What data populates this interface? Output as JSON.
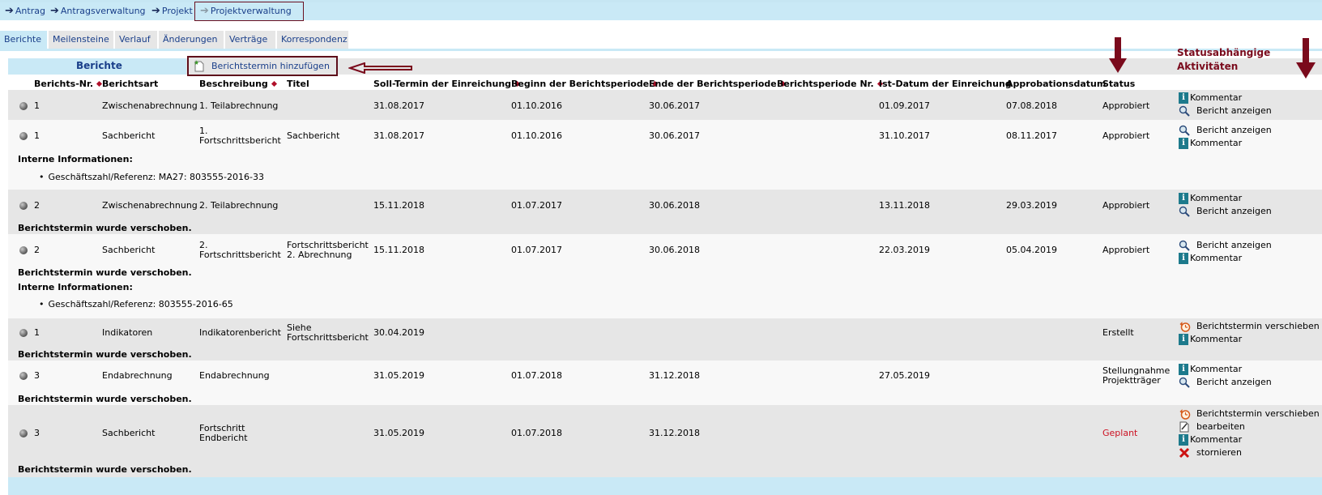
{
  "breadcrumb": [
    {
      "label": "Antrag"
    },
    {
      "label": "Antragsverwaltung"
    },
    {
      "label": "Projekt"
    },
    {
      "label": "Projektverwaltung"
    }
  ],
  "tabs": [
    {
      "label": "Berichte",
      "active": true
    },
    {
      "label": "Meilensteine"
    },
    {
      "label": "Verlauf"
    },
    {
      "label": "Änderungen"
    },
    {
      "label": "Verträge"
    },
    {
      "label": "Korrespondenz"
    }
  ],
  "section": {
    "title": "Berichte",
    "add_button": "Berichtstermin hinzufügen"
  },
  "annotation": {
    "line1": "Statusabhängige",
    "line2": "Aktivitäten"
  },
  "columns": [
    {
      "label": "Berichts-Nr.",
      "sortable": true
    },
    {
      "label": "Berichtsart"
    },
    {
      "label": "Beschreibung",
      "sortable": true
    },
    {
      "label": "Titel"
    },
    {
      "label": "Soll-Termin der Einreichung",
      "sortable": true
    },
    {
      "label": "Beginn der Berichtsperiode",
      "sortable": true
    },
    {
      "label": "Ende der Berichtsperiode",
      "sortable": true
    },
    {
      "label": "Berichtsperiode Nr.",
      "sortable": true
    },
    {
      "label": "Ist-Datum der Einreichung"
    },
    {
      "label": "Approbationsdatum"
    },
    {
      "label": "Status"
    }
  ],
  "rows": [
    {
      "nr": "1",
      "art": "Zwischenabrechnung",
      "beschreibung": "1. Teilabrechnung",
      "titel": "",
      "soll": "31.08.2017",
      "beginn": "01.10.2016",
      "ende": "30.06.2017",
      "periode_nr": "",
      "ist": "01.09.2017",
      "approbation": "07.08.2018",
      "status": "Approbiert",
      "actions": [
        "Kommentar",
        "Bericht anzeigen"
      ]
    },
    {
      "nr": "1",
      "art": "Sachbericht",
      "beschreibung_l1": "1.",
      "beschreibung_l2": "Fortschrittsbericht",
      "titel": "Sachbericht",
      "soll": "31.08.2017",
      "beginn": "01.10.2016",
      "ende": "30.06.2017",
      "periode_nr": "",
      "ist": "31.10.2017",
      "approbation": "08.11.2017",
      "status": "Approbiert",
      "actions": [
        "Bericht anzeigen",
        "Kommentar"
      ],
      "notes": {
        "heading": "Interne Informationen:",
        "item": "Geschäftszahl/Referenz: MA27: 803555-2016-33"
      }
    },
    {
      "nr": "2",
      "art": "Zwischenabrechnung",
      "beschreibung": "2. Teilabrechnung",
      "titel": "",
      "soll": "15.11.2018",
      "beginn": "01.07.2017",
      "ende": "30.06.2018",
      "periode_nr": "",
      "ist": "13.11.2018",
      "approbation": "29.03.2019",
      "status": "Approbiert",
      "actions": [
        "Kommentar",
        "Bericht anzeigen"
      ],
      "moved": "Berichtstermin wurde verschoben."
    },
    {
      "nr": "2",
      "art": "Sachbericht",
      "beschreibung_l1": "2.",
      "beschreibung_l2": "Fortschrittsbericht",
      "titel_l1": "Fortschrittsbericht",
      "titel_l2": "2. Abrechnung",
      "soll": "15.11.2018",
      "beginn": "01.07.2017",
      "ende": "30.06.2018",
      "periode_nr": "",
      "ist": "22.03.2019",
      "approbation": "05.04.2019",
      "status": "Approbiert",
      "actions": [
        "Bericht anzeigen",
        "Kommentar"
      ],
      "moved": "Berichtstermin wurde verschoben.",
      "notes": {
        "heading": "Interne Informationen:",
        "item": "Geschäftszahl/Referenz: 803555-2016-65"
      }
    },
    {
      "nr": "1",
      "art": "Indikatoren",
      "beschreibung": "Indikatorenbericht",
      "titel_l1": "Siehe",
      "titel_l2": "Fortschrittsbericht",
      "soll": "30.04.2019",
      "beginn": "",
      "ende": "",
      "periode_nr": "",
      "ist": "",
      "approbation": "",
      "status": "Erstellt",
      "actions": [
        "Berichtstermin verschieben",
        "Kommentar"
      ],
      "moved": "Berichtstermin wurde verschoben."
    },
    {
      "nr": "3",
      "art": "Endabrechnung",
      "beschreibung": "Endabrechnung",
      "titel": "",
      "soll": "31.05.2019",
      "beginn": "01.07.2018",
      "ende": "31.12.2018",
      "periode_nr": "",
      "ist": "27.05.2019",
      "approbation": "",
      "status_l1": "Stellungnahme",
      "status_l2": "Projektträger",
      "actions": [
        "Kommentar",
        "Bericht anzeigen"
      ],
      "moved": "Berichtstermin wurde verschoben."
    },
    {
      "nr": "3",
      "art": "Sachbericht",
      "beschreibung_l1": "Fortschritt",
      "beschreibung_l2": "Endbericht",
      "titel": "",
      "soll": "31.05.2019",
      "beginn": "01.07.2018",
      "ende": "31.12.2018",
      "periode_nr": "",
      "ist": "",
      "approbation": "",
      "status": "Geplant",
      "actions": [
        "Berichtstermin verschieben",
        "bearbeiten",
        "Kommentar",
        "stornieren"
      ],
      "moved": "Berichtstermin wurde verschoben."
    }
  ],
  "colors": {
    "header_blue": "#c9e9f6",
    "link_blue": "#1a3f8a",
    "annotation_red": "#7a0a1c",
    "status_geplant": "#cc1122"
  },
  "icons": {
    "info": "info-icon",
    "view": "magnifier-icon",
    "reschedule": "clock-icon",
    "edit": "edit-icon",
    "cancel": "cross-icon"
  }
}
